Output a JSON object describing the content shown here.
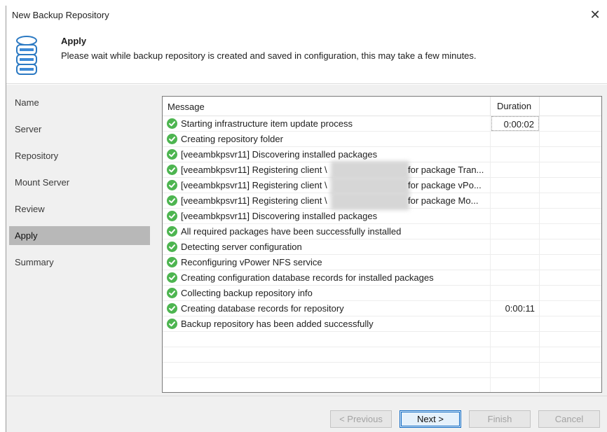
{
  "window": {
    "title": "New Backup Repository",
    "close_glyph": "✕"
  },
  "header": {
    "step_title": "Apply",
    "description": "Please wait while backup repository is created and saved in configuration, this may take a few minutes.",
    "icon": "database-icon"
  },
  "nav": {
    "items": [
      {
        "label": "Name",
        "active": false
      },
      {
        "label": "Server",
        "active": false
      },
      {
        "label": "Repository",
        "active": false
      },
      {
        "label": "Mount Server",
        "active": false
      },
      {
        "label": "Review",
        "active": false
      },
      {
        "label": "Apply",
        "active": true
      },
      {
        "label": "Summary",
        "active": false
      }
    ]
  },
  "log": {
    "columns": {
      "message": "Message",
      "duration": "Duration"
    },
    "rows": [
      {
        "message": "Starting infrastructure item update process",
        "tail": "",
        "redacted": false,
        "duration": "0:00:02"
      },
      {
        "message": "Creating repository folder",
        "tail": "",
        "redacted": false,
        "duration": ""
      },
      {
        "message": "[veeambkpsvr11] Discovering installed packages",
        "tail": "",
        "redacted": false,
        "duration": ""
      },
      {
        "message": "[veeambkpsvr11] Registering client \\",
        "tail": "for package Tran...",
        "redacted": true,
        "duration": ""
      },
      {
        "message": "[veeambkpsvr11] Registering client \\",
        "tail": "for package vPo...",
        "redacted": true,
        "duration": ""
      },
      {
        "message": "[veeambkpsvr11] Registering client \\",
        "tail": "for package Mo...",
        "redacted": true,
        "duration": ""
      },
      {
        "message": "[veeambkpsvr11] Discovering installed packages",
        "tail": "",
        "redacted": false,
        "duration": ""
      },
      {
        "message": "All required packages have been successfully installed",
        "tail": "",
        "redacted": false,
        "duration": ""
      },
      {
        "message": "Detecting server configuration",
        "tail": "",
        "redacted": false,
        "duration": ""
      },
      {
        "message": "Reconfiguring vPower NFS service",
        "tail": "",
        "redacted": false,
        "duration": ""
      },
      {
        "message": "Creating configuration database records for installed packages",
        "tail": "",
        "redacted": false,
        "duration": ""
      },
      {
        "message": "Collecting backup repository info",
        "tail": "",
        "redacted": false,
        "duration": ""
      },
      {
        "message": "Creating database records for repository",
        "tail": "",
        "redacted": false,
        "duration": "0:00:11"
      },
      {
        "message": "Backup repository has been added successfully",
        "tail": "",
        "redacted": false,
        "duration": ""
      }
    ],
    "empty_rows": 4,
    "status_color": "#4db550"
  },
  "buttons": {
    "previous": {
      "label": "< Previous",
      "enabled": false
    },
    "next": {
      "label": "Next >",
      "enabled": true
    },
    "finish": {
      "label": "Finish",
      "enabled": false
    },
    "cancel": {
      "label": "Cancel",
      "enabled": false
    }
  }
}
